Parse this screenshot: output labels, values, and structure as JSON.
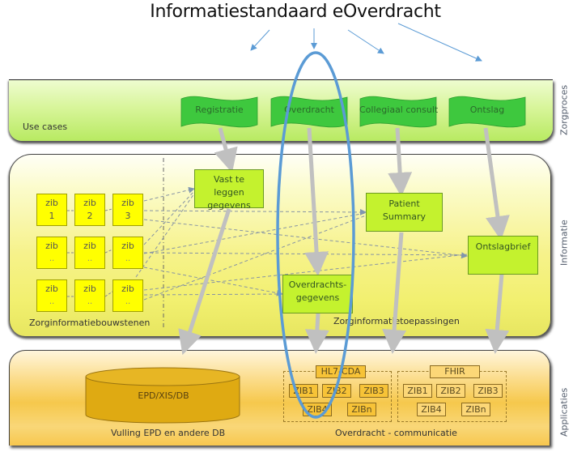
{
  "title": "Informatiestandaard eOverdracht",
  "layers": {
    "zorgproces": {
      "side_label": "Zorgproces",
      "band_label": "Use cases",
      "use_cases": [
        "Registratie",
        "Overdracht",
        "Collegiaal consult",
        "Ontslag"
      ]
    },
    "informatie": {
      "side_label": "Informatie",
      "left_label": "Zorginformatiebouwstenen",
      "right_label": "Zorginformatietoepassingen",
      "zibs": [
        {
          "label": "zib",
          "sub": "1"
        },
        {
          "label": "zib",
          "sub": "2"
        },
        {
          "label": "zib",
          "sub": "3"
        },
        {
          "label": "zib",
          "sub": ".."
        },
        {
          "label": "zib",
          "sub": ".."
        },
        {
          "label": "zib",
          "sub": ".."
        },
        {
          "label": "zib",
          "sub": ".."
        },
        {
          "label": "zib",
          "sub": ".."
        },
        {
          "label": "zib",
          "sub": ".."
        }
      ],
      "applications": {
        "vast": "Vast te leggen gegevens",
        "patient_summary": "Patient Summary",
        "overdrachts": "Overdrachts-gegevens",
        "ontslagbrief": "Ontslagbrief"
      }
    },
    "applicaties": {
      "side_label": "Applicaties",
      "database": "EPD/XIS/DB",
      "db_label": "Vulling EPD en andere DB",
      "comm_label": "Overdracht - communicatie",
      "standards": [
        {
          "name": "HL7-CDA",
          "zibs": [
            "ZIB1",
            "ZIB2",
            "ZIB3",
            "ZIB4",
            "ZIBn"
          ]
        },
        {
          "name": "FHIR",
          "zibs": [
            "ZIB1",
            "ZIB2",
            "ZIB3",
            "ZIB4",
            "ZIBn"
          ]
        }
      ]
    }
  },
  "colors": {
    "highlight_ellipse": "#5b9bd5",
    "flag_green": "#3ec83e",
    "zib_yellow": "#ffff00",
    "app_box_green": "#c4f22e",
    "db_gold": "#e0aa10"
  }
}
